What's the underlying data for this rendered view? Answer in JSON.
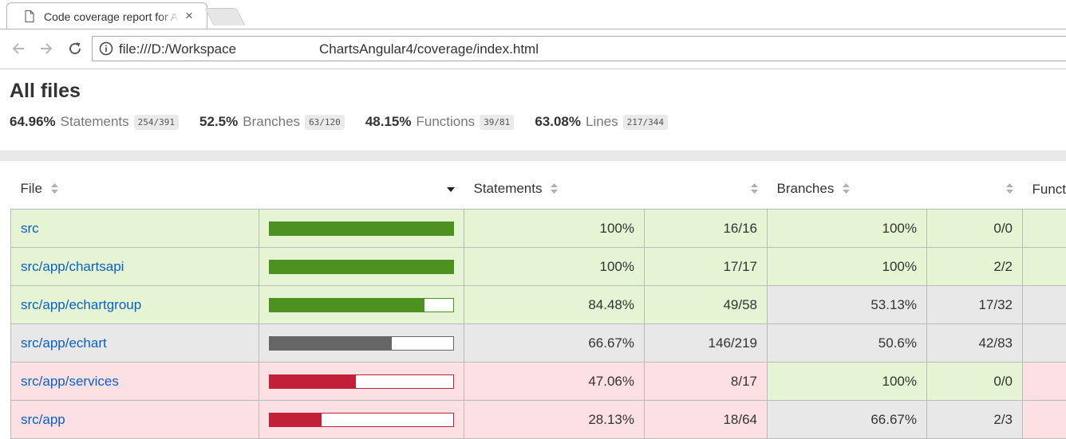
{
  "browser": {
    "tab_title": "Code coverage report for All files",
    "close_glyph": "×",
    "url_visible_start": "file:///D:/Workspace",
    "url_visible_end": "ChartsAngular4/coverage/index.html"
  },
  "report": {
    "title": "All files",
    "summary": [
      {
        "pct": "64.96%",
        "label": "Statements",
        "fraction": "254/391"
      },
      {
        "pct": "52.5%",
        "label": "Branches",
        "fraction": "63/120"
      },
      {
        "pct": "48.15%",
        "label": "Functions",
        "fraction": "39/81"
      },
      {
        "pct": "63.08%",
        "label": "Lines",
        "fraction": "217/344"
      }
    ],
    "columns": {
      "file": "File",
      "statements": "Statements",
      "branches": "Branches",
      "functions": "Functions"
    },
    "rows": [
      {
        "file": "src",
        "stmt_pct": "100%",
        "stmt_frac": "16/16",
        "bar_pct": 100,
        "status": "high",
        "br_pct": "100%",
        "br_frac": "0/0",
        "br_status": "high",
        "fn_status": "high"
      },
      {
        "file": "src/app/chartsapi",
        "stmt_pct": "100%",
        "stmt_frac": "17/17",
        "bar_pct": 100,
        "status": "high",
        "br_pct": "100%",
        "br_frac": "2/2",
        "br_status": "high",
        "fn_status": "high"
      },
      {
        "file": "src/app/echartgroup",
        "stmt_pct": "84.48%",
        "stmt_frac": "49/58",
        "bar_pct": 84.48,
        "status": "high",
        "br_pct": "53.13%",
        "br_frac": "17/32",
        "br_status": "medium",
        "fn_status": "medium"
      },
      {
        "file": "src/app/echart",
        "stmt_pct": "66.67%",
        "stmt_frac": "146/219",
        "bar_pct": 66.67,
        "status": "medium",
        "br_pct": "50.6%",
        "br_frac": "42/83",
        "br_status": "medium",
        "fn_status": "medium"
      },
      {
        "file": "src/app/services",
        "stmt_pct": "47.06%",
        "stmt_frac": "8/17",
        "bar_pct": 47.06,
        "status": "low",
        "br_pct": "100%",
        "br_frac": "0/0",
        "br_status": "high",
        "fn_status": "low"
      },
      {
        "file": "src/app",
        "stmt_pct": "28.13%",
        "stmt_frac": "18/64",
        "bar_pct": 28.13,
        "status": "low",
        "br_pct": "66.67%",
        "br_frac": "2/3",
        "br_status": "medium",
        "fn_status": "low"
      }
    ]
  },
  "colors": {
    "high_fill": "#4d9221",
    "medium_fill": "#666666",
    "low_fill": "#c21f39",
    "high_bg": "#e5f4d3",
    "medium_bg": "#e8e8e8",
    "low_bg": "#fce0e4",
    "link": "#0b5fc9"
  }
}
